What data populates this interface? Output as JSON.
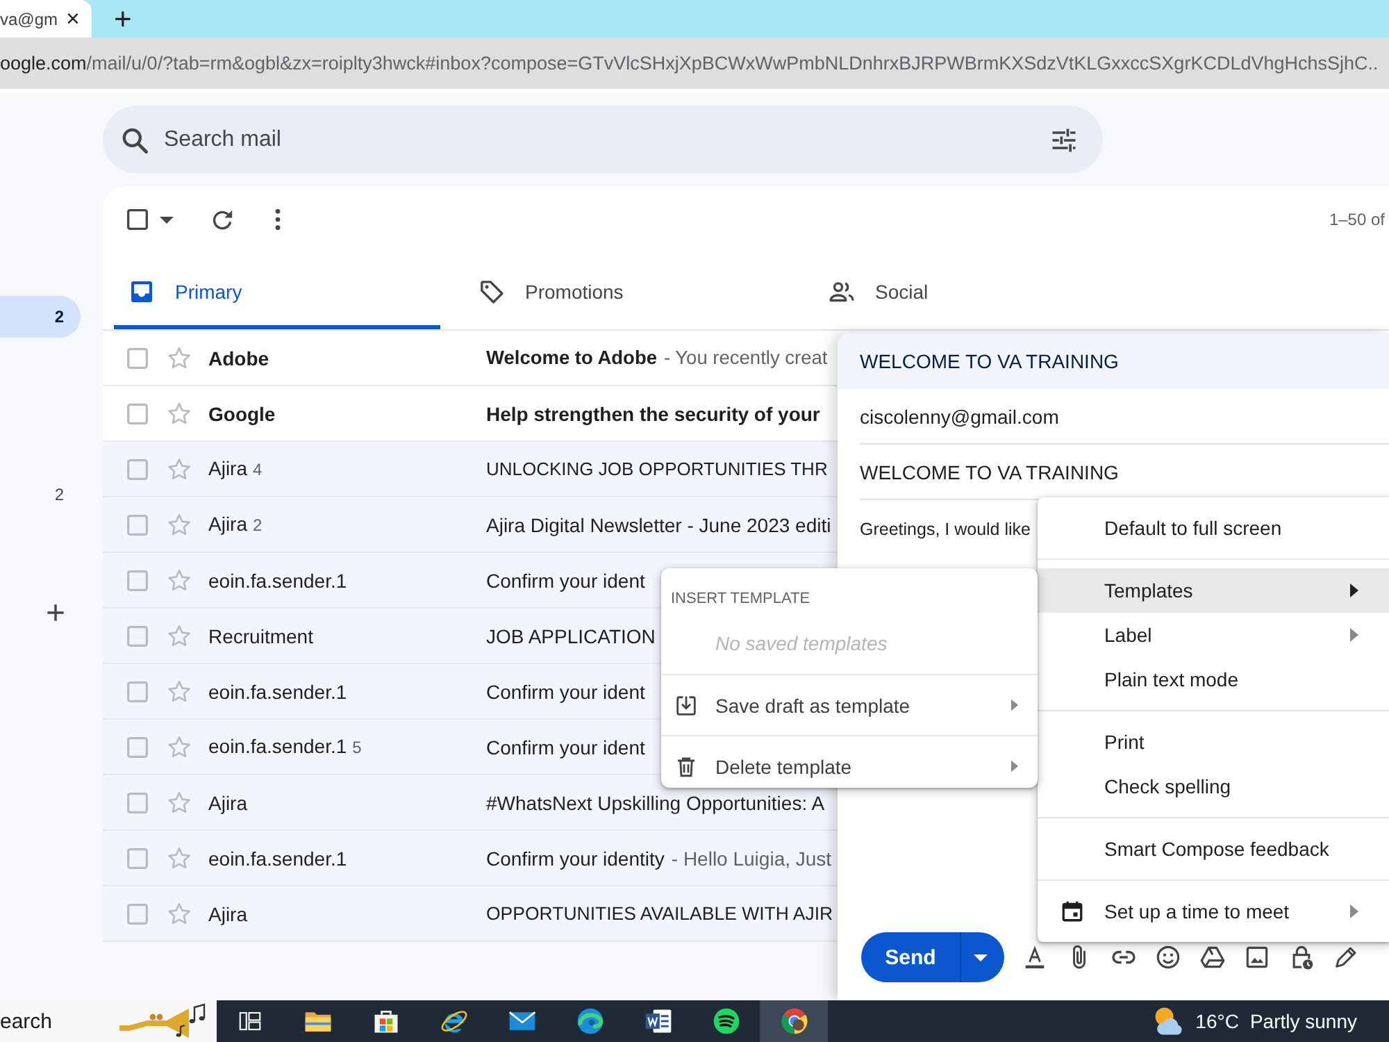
{
  "browser": {
    "tab": {
      "title": "va@gm",
      "close": "×"
    },
    "new_tab": "+",
    "address": {
      "host": "oogle.com",
      "path": "/mail/u/0/?tab=rm&ogbl&zx=roiplty3hwck#inbox?compose=GTvVlcSHxjXpBCWxWwPmbNLDnhrxBJRPWBrmKXSdzVtKLGxxccSXgrKCDLdVhgHchsSjhC.."
    }
  },
  "sidebar": {
    "items": [
      {
        "count": "2",
        "selected": true
      },
      {
        "count": "2",
        "selected": false
      }
    ],
    "create_label": "+"
  },
  "mail_search": {
    "placeholder": "Search mail"
  },
  "toolbar": {
    "select_all": {
      "checked": false
    },
    "page_range": "1–50 of"
  },
  "tabs": [
    {
      "label": "Primary",
      "selected": true
    },
    {
      "label": "Promotions",
      "selected": false
    },
    {
      "label": "Social",
      "selected": false
    }
  ],
  "messages": [
    {
      "sender": "Adobe",
      "unread": true,
      "checked": false,
      "starred": false,
      "subject": "Welcome to Adobe",
      "snippet": "- You recently creat"
    },
    {
      "sender": "Google",
      "unread": true,
      "checked": false,
      "starred": false,
      "subject": "Help strengthen the security of your"
    },
    {
      "sender": "Ajira",
      "thread_count": "4",
      "unread": false,
      "checked": false,
      "starred": false,
      "subject": "UNLOCKING JOB OPPORTUNITIES THR"
    },
    {
      "sender": "Ajira",
      "thread_count": "2",
      "unread": false,
      "checked": false,
      "starred": false,
      "subject": "Ajira Digital Newsletter - June 2023 editi"
    },
    {
      "sender": "eoin.fa.sender.1",
      "unread": false,
      "checked": false,
      "starred": false,
      "subject": "Confirm your ident"
    },
    {
      "sender": "Recruitment",
      "unread": false,
      "checked": false,
      "starred": false,
      "subject": "JOB APPLICATION"
    },
    {
      "sender": "eoin.fa.sender.1",
      "unread": false,
      "checked": false,
      "starred": false,
      "subject": "Confirm your ident"
    },
    {
      "sender": "eoin.fa.sender.1",
      "thread_count": "5",
      "unread": false,
      "checked": false,
      "starred": false,
      "subject": "Confirm your ident"
    },
    {
      "sender": "Ajira",
      "unread": false,
      "checked": false,
      "starred": false,
      "subject": "#WhatsNext Upskilling Opportunities: A"
    },
    {
      "sender": "eoin.fa.sender.1",
      "unread": false,
      "checked": false,
      "starred": false,
      "subject": "Confirm your identity",
      "snippet": "- Hello Luigia, Just"
    },
    {
      "sender": "Ajira",
      "unread": false,
      "checked": false,
      "starred": false,
      "subject": "OPPORTUNITIES AVAILABLE WITH AJIR"
    }
  ],
  "compose": {
    "title": "WELCOME TO VA TRAINING",
    "recipient": "ciscolenny@gmail.com",
    "subject": "WELCOME TO VA TRAINING",
    "body": "Greetings, I would like",
    "send": "Send"
  },
  "options_menu": {
    "groups": [
      [
        {
          "label": "Default to full screen",
          "selected": false,
          "submenu": false
        }
      ],
      [
        {
          "label": "Templates",
          "selected": true,
          "submenu": true
        },
        {
          "label": "Label",
          "selected": false,
          "submenu": true
        },
        {
          "label": "Plain text mode",
          "selected": false,
          "submenu": false
        }
      ],
      [
        {
          "label": "Print",
          "selected": false,
          "submenu": false
        },
        {
          "label": "Check spelling",
          "selected": false,
          "submenu": false
        }
      ],
      [
        {
          "label": "Smart Compose feedback",
          "selected": false,
          "submenu": false
        }
      ],
      [
        {
          "label": "Set up a time to meet",
          "selected": false,
          "submenu": true
        }
      ]
    ]
  },
  "templates_menu": {
    "heading": "INSERT TEMPLATE",
    "empty_note": "No saved templates",
    "items": [
      {
        "label": "Save draft as template",
        "selected": false,
        "submenu": true
      },
      {
        "label": "Delete template",
        "selected": false,
        "submenu": true
      }
    ]
  },
  "taskbar": {
    "search": "earch",
    "apps": [
      {
        "selected": false
      },
      {
        "selected": false
      },
      {
        "selected": false
      },
      {
        "selected": false
      },
      {
        "selected": false
      },
      {
        "selected": false
      },
      {
        "selected": false
      },
      {
        "selected": true
      }
    ],
    "weather": {
      "temperature": "16°C",
      "condition": "Partly sunny"
    }
  }
}
